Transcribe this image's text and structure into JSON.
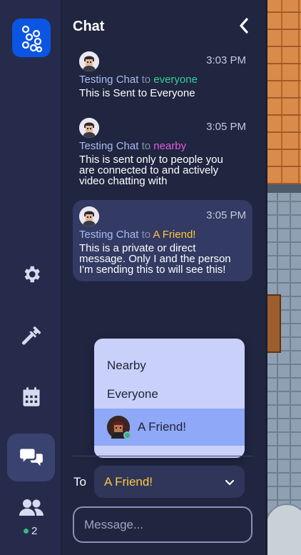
{
  "panel": {
    "title": "Chat"
  },
  "messages": [
    {
      "time": "3:03 PM",
      "sender": "Testing Chat",
      "to_word": "to",
      "recipient": "everyone",
      "text": "This is Sent to Everyone"
    },
    {
      "time": "3:05 PM",
      "sender": "Testing Chat",
      "to_word": "to",
      "recipient": "nearby",
      "text_lines": [
        "This is sent only to people you",
        "are connected to and actively",
        "video chatting with"
      ]
    },
    {
      "time": "3:05 PM",
      "sender": "Testing Chat",
      "to_word": "to",
      "recipient": "A Friend!",
      "text_lines": [
        "This is a private or direct",
        "message. Only I and the person",
        "I'm sending this to will see this!"
      ]
    }
  ],
  "recipient_menu": {
    "options": [
      "Nearby",
      "Everyone",
      "A Friend!"
    ],
    "selected": "A Friend!"
  },
  "composer": {
    "to_label": "To",
    "selected_recipient": "A Friend!",
    "placeholder": "Message..."
  },
  "rail": {
    "online_count": "2"
  },
  "colors": {
    "everyone": "#2fd194",
    "nearby": "#e35ce0",
    "friend": "#ffc940",
    "sender": "#a9bdf2",
    "accent": "#0b55e3"
  },
  "icons": [
    "app-logo-icon",
    "settings-gear-icon",
    "build-hammer-icon",
    "calendar-icon",
    "chat-bubbles-icon",
    "participants-icon",
    "collapse-chevron-icon",
    "dropdown-chevron-icon"
  ]
}
